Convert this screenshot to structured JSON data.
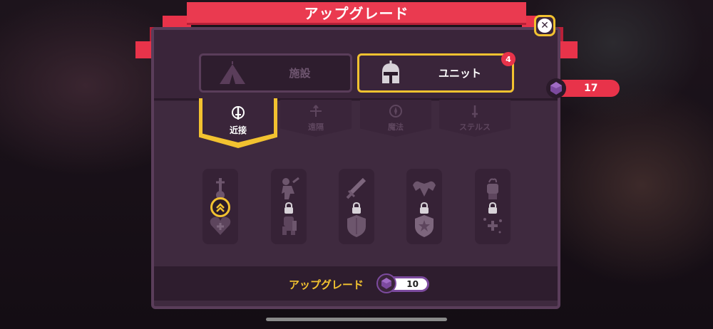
{
  "header": {
    "title": "アップグレード"
  },
  "tabs": [
    {
      "label": "施設",
      "icon": "tent-icon",
      "active": false
    },
    {
      "label": "ユニット",
      "icon": "knight-helmet-icon",
      "active": true,
      "badge": "4"
    }
  ],
  "currency": {
    "value": "17",
    "icon": "purple-gem-icon"
  },
  "sub_tabs": [
    {
      "label": "近接",
      "icon": "sword-icon",
      "active": true
    },
    {
      "label": "遠隔",
      "icon": "arrows-icon",
      "active": false
    },
    {
      "label": "魔法",
      "icon": "magic-circle-icon",
      "active": false
    },
    {
      "label": "ステルス",
      "icon": "dagger-icon",
      "active": false
    }
  ],
  "upgrade_columns": [
    {
      "top_icon": "sword-medal-icon",
      "bottom_icon": "heart-plus-icon",
      "state": "upgradable"
    },
    {
      "top_icon": "warrior-strike-icon",
      "bottom_icon": "armored-knight-icon",
      "state": "locked"
    },
    {
      "top_icon": "greatsword-icon",
      "bottom_icon": "shield-icon",
      "state": "locked"
    },
    {
      "top_icon": "shoulder-armor-icon",
      "bottom_icon": "star-shield-icon",
      "state": "locked"
    },
    {
      "top_icon": "fist-icon",
      "bottom_icon": "sparkle-plus-icon",
      "state": "locked"
    }
  ],
  "footer": {
    "upgrade_label": "アップグレード",
    "cost": "10",
    "cost_icon": "purple-gem-icon"
  },
  "colors": {
    "accent_gold": "#f2c230",
    "ribbon_red": "#ea3a50",
    "panel": "#3f2a3f",
    "gem_purple": "#7c4a9e"
  }
}
